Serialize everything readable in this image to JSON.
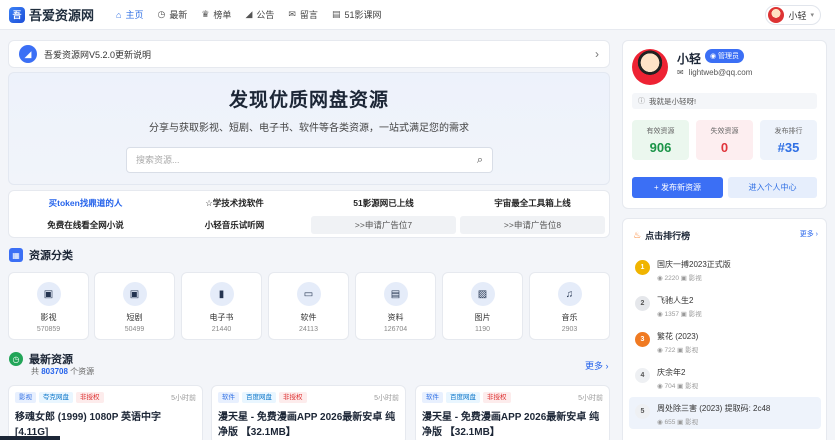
{
  "site": {
    "logo_glyph": "吾",
    "name": "吾爱资源网"
  },
  "nav": [
    {
      "icon": "⌂",
      "icon_name": "home-icon",
      "label": "主页",
      "active": true
    },
    {
      "icon": "◷",
      "icon_name": "clock-icon",
      "label": "最新",
      "active": false
    },
    {
      "icon": "♛",
      "icon_name": "crown-icon",
      "label": "榜单",
      "active": false
    },
    {
      "icon": "◢",
      "icon_name": "megaphone-icon",
      "label": "公告",
      "active": false
    },
    {
      "icon": "✉",
      "icon_name": "mail-icon",
      "label": "留言",
      "active": false
    },
    {
      "icon": "▤",
      "icon_name": "film-icon",
      "label": "51影课网",
      "active": false
    }
  ],
  "user_chip": {
    "name": "小轻",
    "caret": "▾"
  },
  "notice": {
    "text": "吾爱资源网V5.2.0更新说明",
    "arrow": "›"
  },
  "hero": {
    "title": "发现优质网盘资源",
    "subtitle": "分享与获取影视、短剧、电子书、软件等各类资源，一站式满足您的需求",
    "search_placeholder": "搜索资源...",
    "search_icon": "⌕"
  },
  "quick_links": [
    {
      "label": "买token找鼎道的人",
      "style": "blue"
    },
    {
      "label": "☆学技术找软件",
      "style": ""
    },
    {
      "label": "51影源网已上线",
      "style": ""
    },
    {
      "label": "宇宙最全工具箱上线",
      "style": ""
    },
    {
      "label": "免费在线看全网小说",
      "style": ""
    },
    {
      "label": "小轻音乐试听网",
      "style": ""
    },
    {
      "label": ">>申请广告位7",
      "style": "ad"
    },
    {
      "label": ">>申请广告位8",
      "style": "ad"
    }
  ],
  "categories_section": {
    "title": "资源分类",
    "icon": "▦"
  },
  "categories": [
    {
      "icon": "▣",
      "icon_name": "film-icon",
      "name": "影视",
      "count": "570859"
    },
    {
      "icon": "▣",
      "icon_name": "clapper-icon",
      "name": "短剧",
      "count": "50499"
    },
    {
      "icon": "▮",
      "icon_name": "book-icon",
      "name": "电子书",
      "count": "21440"
    },
    {
      "icon": "▭",
      "icon_name": "laptop-icon",
      "name": "软件",
      "count": "24113"
    },
    {
      "icon": "▤",
      "icon_name": "document-icon",
      "name": "资料",
      "count": "126704"
    },
    {
      "icon": "▨",
      "icon_name": "image-icon",
      "name": "图片",
      "count": "1190"
    },
    {
      "icon": "♫",
      "icon_name": "music-icon",
      "name": "音乐",
      "count": "2903"
    }
  ],
  "latest_section": {
    "title": "最新资源",
    "icon": "◷",
    "count_prefix": "共",
    "count": "803708",
    "count_suffix": "个资源",
    "more": "更多 ›"
  },
  "resources": [
    {
      "tags": [
        "影视",
        "夸克网盘",
        "非授权"
      ],
      "time": "5小时前",
      "title": "移魂女郎 (1999) 1080P 英语中字 [4.11G]"
    },
    {
      "tags": [
        "软件",
        "百度网盘",
        "非授权"
      ],
      "time": "5小时前",
      "title": "漫天星 - 免费漫画APP 2026最新安卓 纯净版 【32.1MB】"
    },
    {
      "tags": [
        "软件",
        "百度网盘",
        "非授权"
      ],
      "time": "5小时前",
      "title": "漫天星 - 免费漫画APP 2026最新安卓 纯净版 【32.1MB】"
    }
  ],
  "profile": {
    "name": "小轻",
    "badge": "◉ 管理员",
    "email_icon": "✉",
    "email": "lightweb@qq.com",
    "bio_icon": "ⓘ",
    "bio": "我就是小轻呀!",
    "stats": [
      {
        "label": "有效资源",
        "value": "906"
      },
      {
        "label": "失效资源",
        "value": "0"
      },
      {
        "label": "发布排行",
        "value": "#35"
      }
    ],
    "publish_button": "+ 发布新资源",
    "center_button": "进入个人中心"
  },
  "ranking": {
    "title": "点击排行榜",
    "icon": "♨",
    "more": "更多 ›",
    "items": [
      {
        "rank": "1",
        "title": "国庆一搏2023正式版",
        "views": "◉ 2220",
        "cat": "▣ 影视"
      },
      {
        "rank": "2",
        "title": "飞驰人生2",
        "views": "◉ 1357",
        "cat": "▣ 影视"
      },
      {
        "rank": "3",
        "title": "繁花 (2023)",
        "views": "◉ 722",
        "cat": "▣ 影视"
      },
      {
        "rank": "4",
        "title": "庆余年2",
        "views": "◉ 704",
        "cat": "▣ 影视"
      },
      {
        "rank": "5",
        "title": "周处除三害 (2023) 提取码: 2c48",
        "views": "◉ 655",
        "cat": "▣ 影视"
      }
    ]
  }
}
